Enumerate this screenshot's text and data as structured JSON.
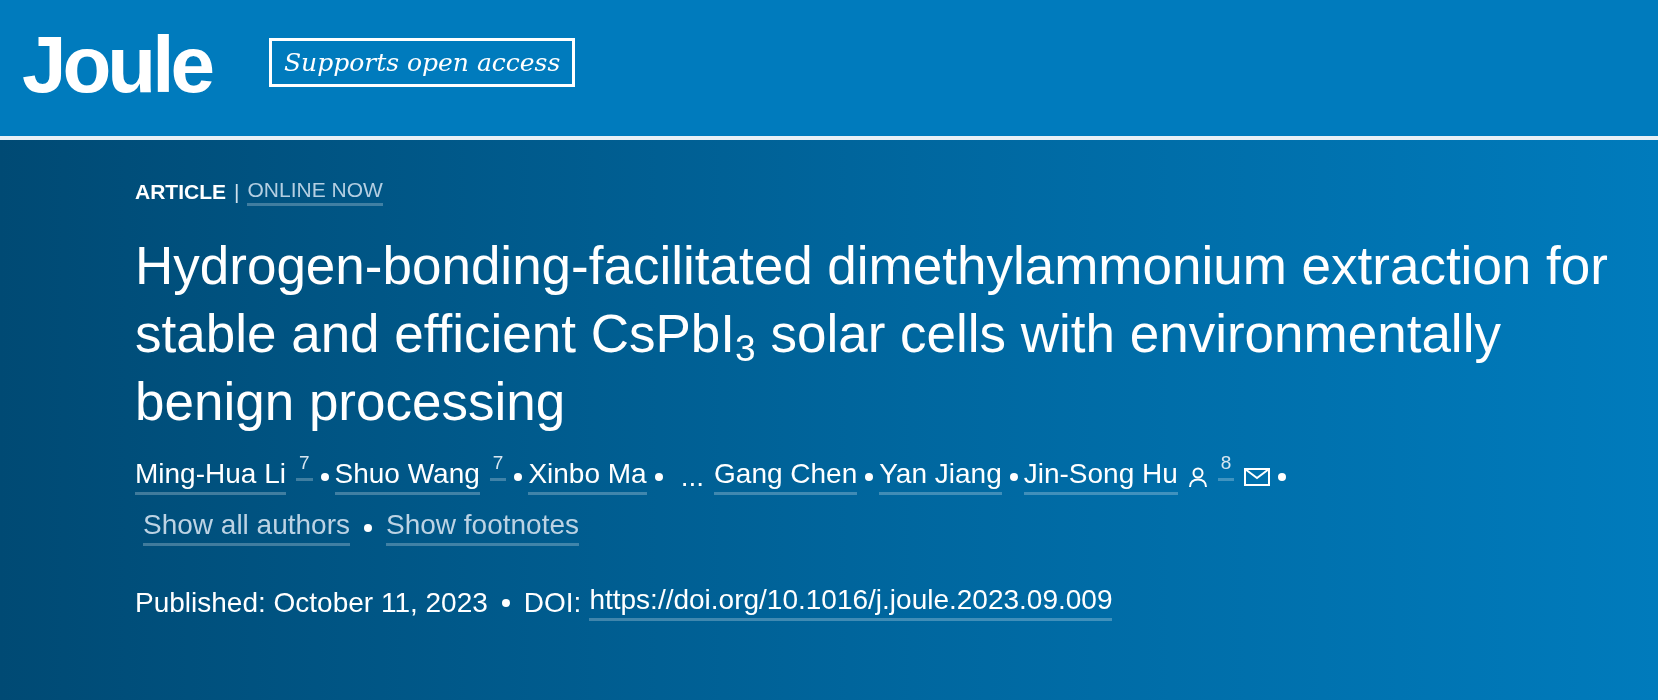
{
  "header": {
    "logo": "Joule",
    "tagline": "Supports open access"
  },
  "article": {
    "type": "ARTICLE",
    "divider": "|",
    "status": "ONLINE NOW",
    "title": "Hydrogen-bonding-facilitated dimethylammonium extraction for stable and efficient CsPbI$_{3}$ solar cells with environmentally benign processing",
    "authors": [
      {
        "kind": "author",
        "name": "Ming-Hua Li",
        "footnote": "7"
      },
      {
        "kind": "author",
        "name": "Shuo Wang",
        "footnote": "7"
      },
      {
        "kind": "author",
        "name": "Xinbo Ma"
      },
      {
        "kind": "ellipsis",
        "text": "..."
      },
      {
        "kind": "author",
        "name": "Gang Chen"
      },
      {
        "kind": "author",
        "name": "Yan Jiang"
      },
      {
        "kind": "author",
        "name": "Jin-Song Hu",
        "footnote": "8",
        "corresponding": true,
        "email": true
      }
    ],
    "author_links": [
      "Show all authors",
      "Show footnotes"
    ],
    "published": "Published: October 11, 2023",
    "doi_label": "DOI:",
    "doi": "https://doi.org/10.1016/j.joule.2023.09.009"
  }
}
